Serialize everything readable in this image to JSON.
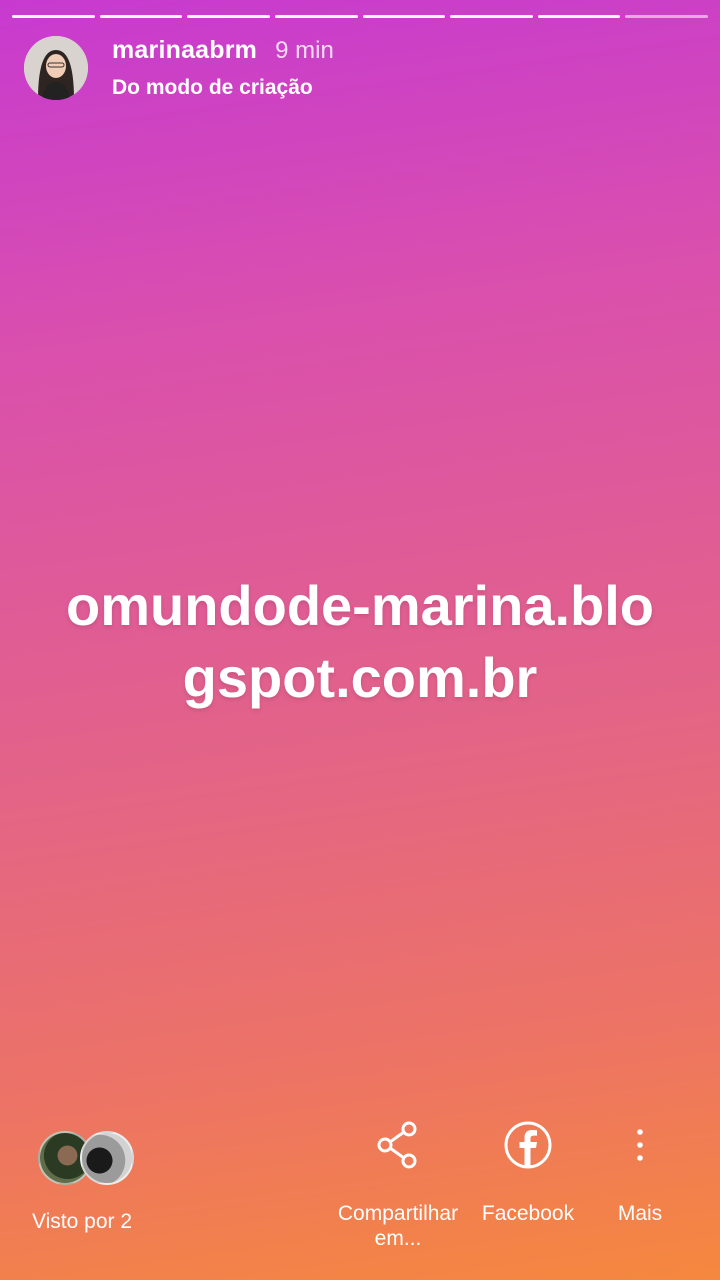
{
  "story": {
    "progress_segments": 8,
    "username": "marinaabrm",
    "time": "9 min",
    "subtitle": "Do modo de criação",
    "text_line1": "omundode-marina.blo",
    "text_line2": "gspot.com.br"
  },
  "footer": {
    "seen_by": "Visto por 2",
    "actions": [
      {
        "label_line1": "Compartilhar",
        "label_line2": "em...",
        "icon": "share-icon"
      },
      {
        "label_line1": "Facebook",
        "icon": "facebook-icon"
      },
      {
        "label_line1": "Mais",
        "icon": "more-vertical-icon"
      }
    ]
  },
  "colors": {
    "gradient_top": "#c73ad0",
    "gradient_bottom": "#f5883e",
    "text": "#ffffff"
  }
}
